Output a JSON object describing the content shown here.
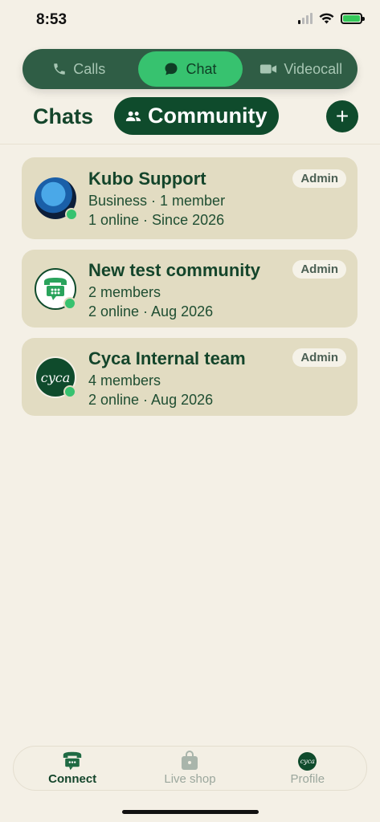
{
  "status_bar": {
    "time": "8:53"
  },
  "mode_switch": {
    "items": [
      {
        "label": "Calls",
        "icon": "phone-icon"
      },
      {
        "label": "Chat",
        "icon": "chat-bubble-icon"
      },
      {
        "label": "Videocall",
        "icon": "video-camera-icon"
      }
    ],
    "selected": "Chat"
  },
  "tabs": {
    "chats_label": "Chats",
    "community_label": "Community",
    "add_icon": "plus-icon"
  },
  "communities": [
    {
      "name": "Kubo Support",
      "line1": "Business · 1 member",
      "line2": "1 online · Since 2026",
      "role": "Admin",
      "avatar": "globe-avatar"
    },
    {
      "name": "New test community",
      "line1": "2 members",
      "line2": "2 online · Aug 2026",
      "role": "Admin",
      "avatar": "phone-logo-avatar"
    },
    {
      "name": "Cyca Internal team",
      "line1": "4 members",
      "line2": "2 online · Aug 2026",
      "role": "Admin",
      "avatar": "cyca-logo-avatar",
      "avatar_text": "cyca"
    }
  ],
  "bottom_nav": {
    "items": [
      {
        "label": "Connect",
        "icon": "phone-chat-icon",
        "active": true
      },
      {
        "label": "Live shop",
        "icon": "shopping-bag-icon",
        "active": false
      },
      {
        "label": "Profile",
        "icon": "cyca-avatar-icon",
        "active": false
      }
    ],
    "profile_avatar_text": "cyca"
  },
  "colors": {
    "accent": "#37c26f",
    "primary": "#0f4b2c",
    "card": "#e2dcc2",
    "background": "#f4f0e6"
  }
}
